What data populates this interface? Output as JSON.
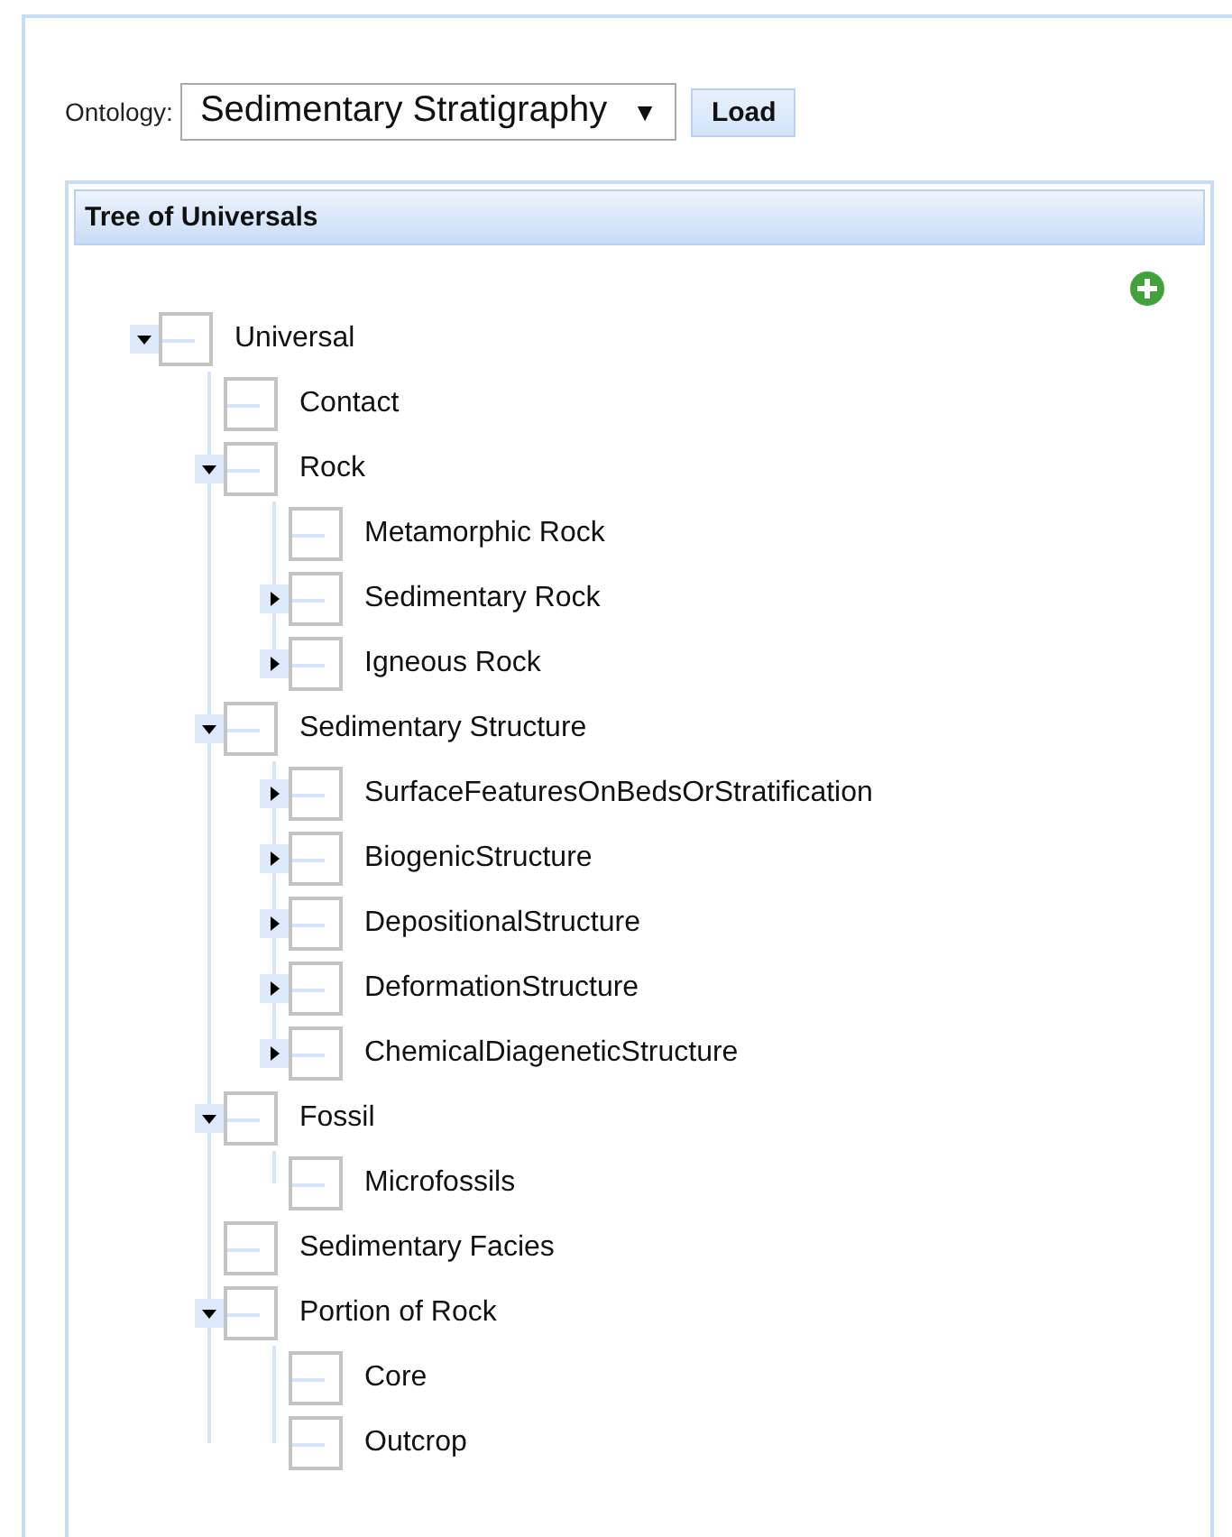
{
  "ontology_label": "Ontology:",
  "ontology_select": {
    "value": "Sedimentary Stratigraphy",
    "arrow": "▼"
  },
  "load_button": "Load",
  "tree_panel": {
    "title": "Tree of Universals",
    "tree": [
      {
        "label": "Universal",
        "expanded": true,
        "children": [
          {
            "label": "Contact"
          },
          {
            "label": "Rock",
            "expanded": true,
            "children": [
              {
                "label": "Metamorphic Rock"
              },
              {
                "label": "Sedimentary Rock",
                "expanded": false
              },
              {
                "label": "Igneous Rock",
                "expanded": false
              }
            ]
          },
          {
            "label": "Sedimentary Structure",
            "expanded": true,
            "children": [
              {
                "label": "SurfaceFeaturesOnBedsOrStratification",
                "expanded": false
              },
              {
                "label": "BiogenicStructure",
                "expanded": false
              },
              {
                "label": "DepositionalStructure",
                "expanded": false
              },
              {
                "label": "DeformationStructure",
                "expanded": false
              },
              {
                "label": "ChemicalDiageneticStructure",
                "expanded": false
              }
            ]
          },
          {
            "label": "Fossil",
            "expanded": true,
            "children": [
              {
                "label": "Microfossils"
              }
            ]
          },
          {
            "label": "Sedimentary Facies"
          },
          {
            "label": "Portion of Rock",
            "expanded": true,
            "children": [
              {
                "label": "Core"
              },
              {
                "label": "Outcrop"
              }
            ]
          }
        ]
      }
    ]
  }
}
